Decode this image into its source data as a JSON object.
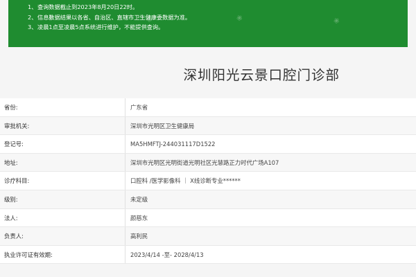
{
  "notice": {
    "lines": [
      {
        "num": "1、",
        "text": "查询数据截止到2023年8月20日22时。"
      },
      {
        "num": "2、",
        "text": "信息数据结果以各省、自治区、直辖市卫生健康委数据为准。"
      },
      {
        "num": "3、",
        "text": "凌晨1点至凌晨5点系统进行维护，不能提供查询。"
      }
    ],
    "background_color": "#1f8c30"
  },
  "clinic": {
    "name": "深圳阳光云景口腔门诊部"
  },
  "details": [
    {
      "label": "省份:",
      "value": "广东省"
    },
    {
      "label": "审批机关:",
      "value": "深圳市光明区卫生健康局"
    },
    {
      "label": "登记号:",
      "value": "MA5HMFTJ-244031117D1522"
    },
    {
      "label": "地址:",
      "value": "深圳市光明区光明街道光明社区光慧路正力时代广场A107"
    },
    {
      "label": "诊疗科目:",
      "value": "口腔科 /医学影像科 ｜ X线诊断专业******"
    },
    {
      "label": "级别:",
      "value": "未定级"
    },
    {
      "label": "法人:",
      "value": "颜慈东"
    },
    {
      "label": "负责人:",
      "value": "高利民"
    },
    {
      "label": "执业许可证有效期:",
      "value": "2023/4/14 -至- 2028/4/13"
    }
  ]
}
